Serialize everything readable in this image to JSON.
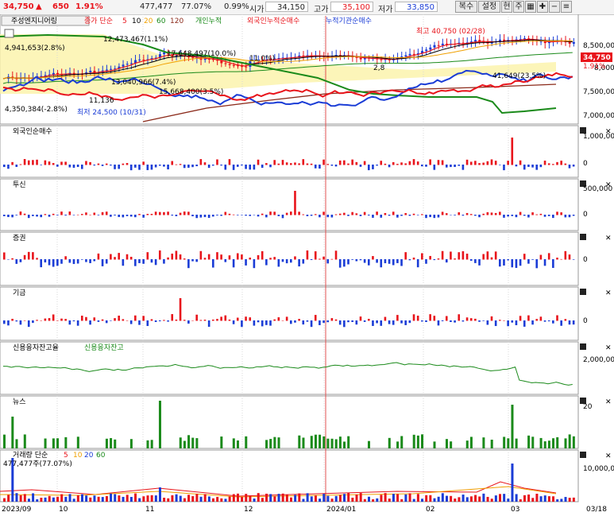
{
  "toolbar": {
    "price": "34,750",
    "arrow": "▲",
    "change": "650",
    "change_pct": "1.91%",
    "volume": "477,477",
    "vol_ratio": "77.07%",
    "turnover": "0.99%",
    "open_label": "시가",
    "open_value": "34,150",
    "high_label": "고가",
    "high_value": "35,100",
    "low_label": "저가",
    "low_value": "33,850",
    "buttons": [
      "복수",
      "설정",
      "현",
      "주"
    ]
  },
  "legend": {
    "stock_name": "주성엔지니어링",
    "ma_label": "종가 단순",
    "ma_periods": [
      "5",
      "10",
      "20",
      "60",
      "120"
    ],
    "series": [
      "개인누적",
      "외국인누적순매수",
      "누적기관순매수"
    ]
  },
  "price_panel": {
    "annotations": [
      "12,473,467(1.1%)",
      "4,941,653(2.8%)",
      "17,648,497(10.0%)",
      "11.0%)",
      "13,040,966(7.4%)",
      "11,136",
      "15,668,400(3.5%)",
      "4,350,384(-2.8%)",
      "최저 24,500 (10/31)",
      "최고 40,750 (02/28)",
      "41,649(23.5%)",
      "2,8"
    ],
    "price_badge": "34,750",
    "pct_badge": "1.91%",
    "axis": [
      "8,500,000",
      "8,000",
      "7,500,000",
      "7,000,000"
    ]
  },
  "panels": [
    {
      "title": "외국인순매수",
      "axis_top": "1,000,000",
      "axis_zero": "0"
    },
    {
      "title": "투신",
      "axis_top": "500,000",
      "axis_zero": "0"
    },
    {
      "title": "증권",
      "axis_top": "",
      "axis_zero": "0"
    },
    {
      "title": "기금",
      "axis_top": "",
      "axis_zero": "0"
    },
    {
      "title": "신용융자잔고율",
      "title2": "신용융자잔고",
      "axis_top": "2,000,000",
      "axis_zero": "0"
    },
    {
      "title": "뉴스",
      "axis_top": "20",
      "axis_zero": ""
    },
    {
      "title": "거래량 단순",
      "axis_top": "10,000,000",
      "axis_zero": ""
    }
  ],
  "volume_legend": {
    "label": "거래량 단순",
    "periods": [
      "5",
      "10",
      "20",
      "60"
    ],
    "current": "477,477주(77.07%)"
  },
  "xaxis": [
    "2023/09",
    "10",
    "11",
    "12",
    "2024/01",
    "02",
    "03",
    "03/18"
  ],
  "colors": {
    "up": "#e8141b",
    "down": "#1a3cd6",
    "green": "#1a8a1a",
    "brown": "#8b2a1a",
    "orange": "#f0a000",
    "yellow_fill": "#fbf3a8",
    "vline": "#e05050"
  }
}
